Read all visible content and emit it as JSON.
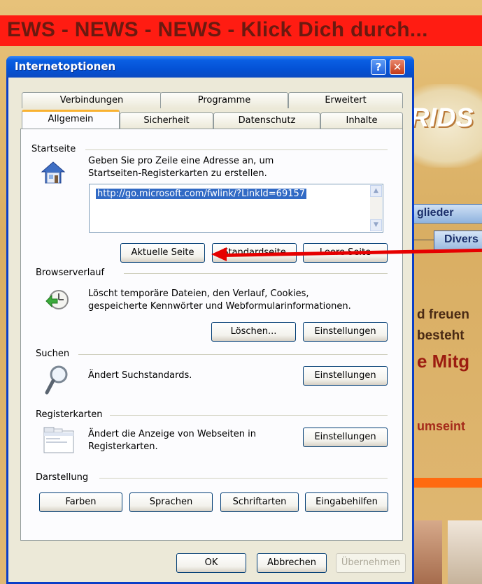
{
  "background": {
    "banner": "EWS - NEWS - NEWS - Klick Dich durch...",
    "logo_text": "RIDS",
    "nav_btn1": "glieder",
    "nav_btn2": "Divers",
    "text_lines": [
      "d freuen",
      "besteht",
      "e Mitg",
      "umseint"
    ]
  },
  "dialog": {
    "title": "Internetoptionen",
    "help_label": "?",
    "close_label": "✕",
    "tabs_back": [
      "Verbindungen",
      "Programme",
      "Erweitert"
    ],
    "tabs_front": [
      "Allgemein",
      "Sicherheit",
      "Datenschutz",
      "Inhalte"
    ],
    "startseite": {
      "heading": "Startseite",
      "description_1": "Geben Sie pro Zeile eine Adresse an, um",
      "description_2": "Startseiten-Registerkarten zu erstellen.",
      "url": "http://go.microsoft.com/fwlink/?LinkId=69157",
      "btn_current": "Aktuelle Seite",
      "btn_standard": "Standardseite",
      "btn_empty": "Leere Seite"
    },
    "browserverlauf": {
      "heading": "Browserverlauf",
      "description_1": "Löscht temporäre Dateien, den Verlauf, Cookies,",
      "description_2": "gespeicherte Kennwörter und Webformularinformationen.",
      "btn_delete": "Löschen...",
      "btn_settings": "Einstellungen"
    },
    "suchen": {
      "heading": "Suchen",
      "description": "Ändert Suchstandards.",
      "btn_settings": "Einstellungen"
    },
    "registerkarten": {
      "heading": "Registerkarten",
      "description_1": "Ändert die Anzeige von Webseiten in",
      "description_2": "Registerkarten.",
      "btn_settings": "Einstellungen"
    },
    "darstellung": {
      "heading": "Darstellung",
      "btn_colors": "Farben",
      "btn_languages": "Sprachen",
      "btn_fonts": "Schriftarten",
      "btn_accessibility": "Eingabehilfen"
    },
    "footer": {
      "ok": "OK",
      "cancel": "Abbrechen",
      "apply": "Übernehmen"
    }
  },
  "colors": {
    "title_bar": "#0452d6",
    "dialog_bg": "#ece9d8",
    "annotation_arrow": "#e60000",
    "banner_bg": "#ff1c12"
  }
}
